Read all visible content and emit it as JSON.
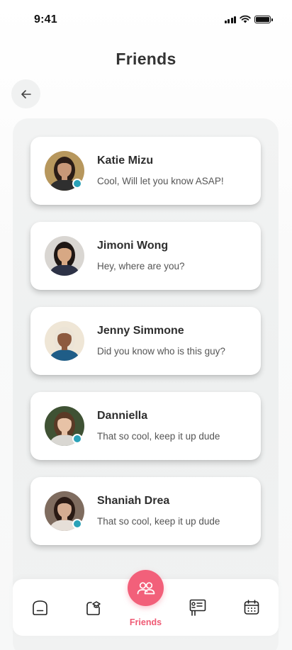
{
  "status_bar": {
    "time": "9:41"
  },
  "header": {
    "title": "Friends"
  },
  "friends": [
    {
      "name": "Katie Mizu",
      "message": "Cool, Will let you know ASAP!",
      "online": true,
      "skin": "#c99878",
      "hair": "#2b1d17",
      "bg": "#b7975d",
      "shirt": "#2f2f2f"
    },
    {
      "name": "Jimoni Wong",
      "message": "Hey, where are you?",
      "online": false,
      "skin": "#d7a884",
      "hair": "#1f1714",
      "bg": "#d9d6d2",
      "shirt": "#2d3246"
    },
    {
      "name": "Jenny Simmone",
      "message": "Did you know who is this guy?",
      "online": false,
      "skin": "#8d5a3f",
      "hair": "#ece4d6",
      "bg": "#efe6d6",
      "shirt": "#1f5d87"
    },
    {
      "name": "Danniella",
      "message": "That so cool, keep it up dude",
      "online": true,
      "skin": "#e7c2a6",
      "hair": "#5a3a26",
      "bg": "#3f5234",
      "shirt": "#d9d7d2"
    },
    {
      "name": "Shaniah Drea",
      "message": "That so cool, keep it up dude",
      "online": true,
      "skin": "#d6ad92",
      "hair": "#2a1a14",
      "bg": "#7f6c5f",
      "shirt": "#e6dfd8"
    }
  ],
  "nav": {
    "items": [
      {
        "icon": "home-icon"
      },
      {
        "icon": "store-icon"
      },
      {
        "icon": "friends-icon",
        "label": "Friends",
        "active": true
      },
      {
        "icon": "board-icon"
      },
      {
        "icon": "calendar-icon"
      }
    ],
    "active_label": "Friends"
  },
  "colors": {
    "accent": "#f2607a",
    "online": "#2aa2b8",
    "title": "#333333"
  }
}
